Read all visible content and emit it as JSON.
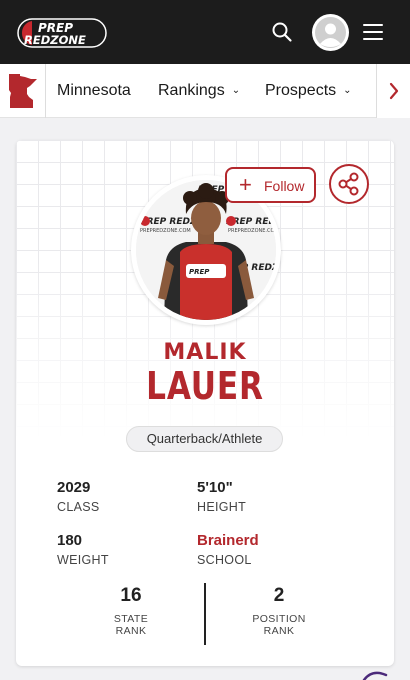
{
  "header": {
    "logo_line1": "PREP",
    "logo_line2": "REDZONE"
  },
  "nav": {
    "state": "Minnesota",
    "rankings": "Rankings",
    "prospects": "Prospects"
  },
  "profile": {
    "first_name": "MALIK",
    "last_name": "LAUER",
    "follow_label": "Follow",
    "position": "Quarterback/Athlete",
    "stats": {
      "class_value": "2029",
      "class_label": "CLASS",
      "height_value": "5'10\"",
      "height_label": "HEIGHT",
      "weight_value": "180",
      "weight_label": "WEIGHT",
      "school_value": "Brainerd",
      "school_label": "SCHOOL"
    },
    "ranks": {
      "state_value": "16",
      "state_label_1": "STATE",
      "state_label_2": "RANK",
      "position_value": "2",
      "position_label_1": "POSITION",
      "position_label_2": "RANK"
    },
    "backdrop_text": "PREP REDZONE",
    "backdrop_url": "PREPREDZONE.COM"
  },
  "colors": {
    "brand_red": "#b3282d",
    "header_bg": "#1c1c1c"
  },
  "icons": [
    "search-icon",
    "hamburger-menu-icon",
    "share-icon",
    "plus-icon",
    "chevron-down-icon",
    "chevron-right-icon",
    "minnesota-map-icon"
  ]
}
